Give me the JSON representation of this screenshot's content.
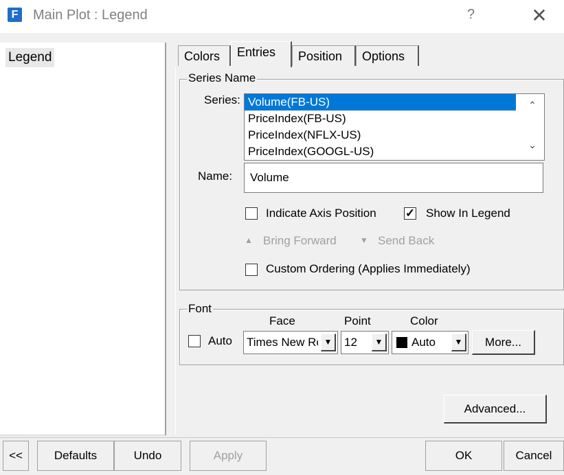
{
  "window": {
    "title": "Main Plot : Legend",
    "app_icon_letter": "F",
    "help_label": "?",
    "close_label": "✕",
    "accent": "#0078d7"
  },
  "tree": {
    "items": [
      "Legend"
    ]
  },
  "tabs": [
    "Colors",
    "Entries",
    "Position",
    "Options"
  ],
  "active_tab": "Entries",
  "series_group": {
    "legend": "Series Name",
    "series_label": "Series:",
    "items": [
      "Volume(FB-US)",
      "PriceIndex(FB-US)",
      "PriceIndex(NFLX-US)",
      "PriceIndex(GOOGL-US)"
    ],
    "selected": "Volume(FB-US)",
    "name_label": "Name:",
    "name_value": "Volume",
    "indicate_axis_label": "Indicate Axis Position",
    "indicate_axis_checked": false,
    "show_in_legend_label": "Show In Legend",
    "show_in_legend_checked": true,
    "bring_forward_label": "Bring Forward",
    "send_back_label": "Send Back",
    "custom_ordering_label": "Custom Ordering (Applies Immediately)",
    "custom_ordering_checked": false
  },
  "font_group": {
    "legend": "Font",
    "face_header": "Face",
    "point_header": "Point",
    "color_header": "Color",
    "auto_label": "Auto",
    "auto_checked": false,
    "face_value": "Times New Roman",
    "point_value": "12",
    "color_value": "Auto",
    "color_swatch": "#000000",
    "more_label": "More..."
  },
  "advanced_label": "Advanced...",
  "bottom": {
    "back_label": "<<",
    "defaults_label": "Defaults",
    "undo_label": "Undo",
    "apply_label": "Apply",
    "ok_label": "OK",
    "cancel_label": "Cancel"
  }
}
